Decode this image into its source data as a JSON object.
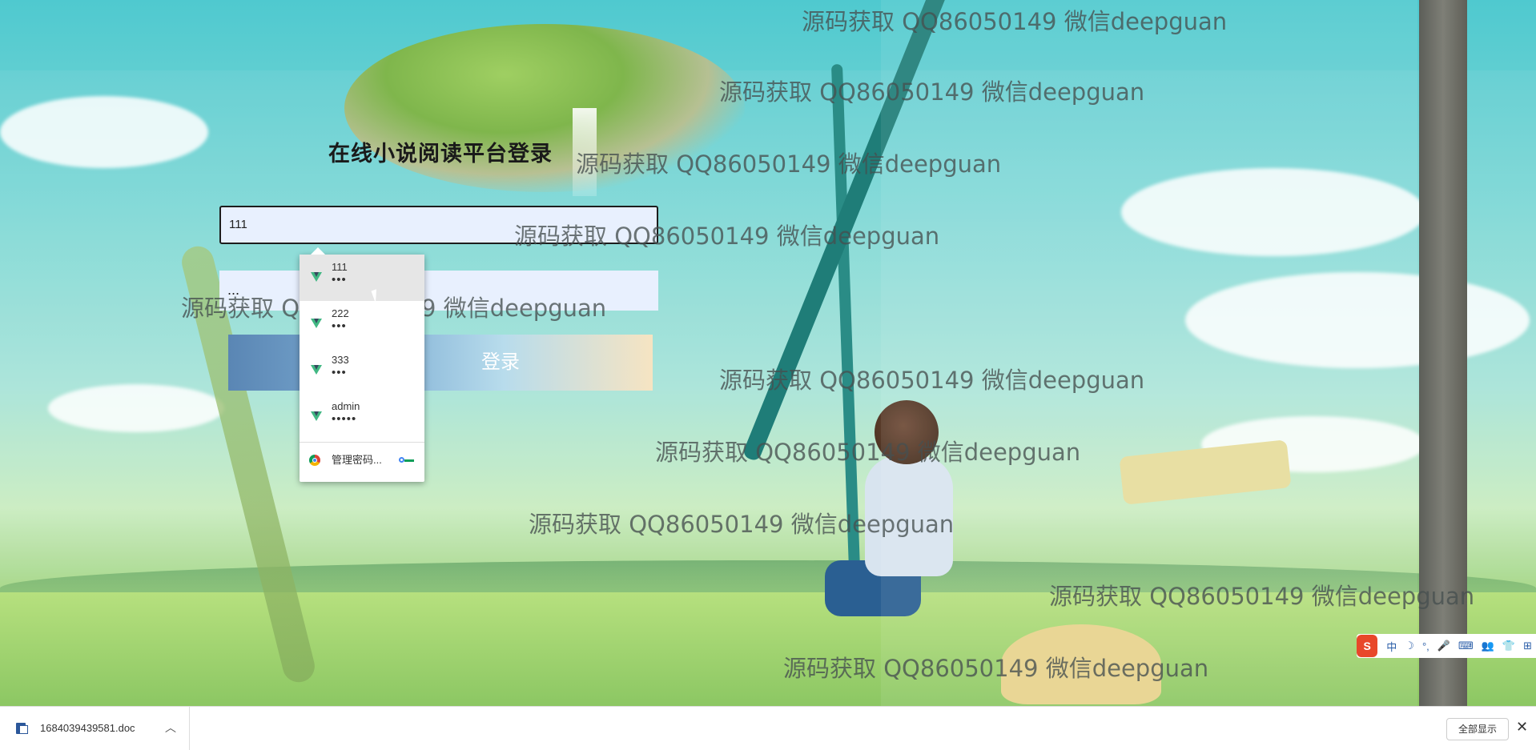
{
  "login": {
    "title": "在线小说阅读平台登录",
    "username_value": "111",
    "password_value": "...",
    "login_button": "登录"
  },
  "autofill": {
    "items": [
      {
        "user": "111",
        "pass": "•••"
      },
      {
        "user": "222",
        "pass": "•••"
      },
      {
        "user": "333",
        "pass": "•••"
      },
      {
        "user": "admin",
        "pass": "•••••"
      }
    ],
    "manage_label": "管理密码..."
  },
  "watermark": {
    "text": "源码获取 QQ86050149 微信deepguan"
  },
  "ime": {
    "logo": "S",
    "mode": "中",
    "items": [
      "☽",
      "°,",
      "🎤",
      "⌨",
      "👥",
      "👕",
      "⊞"
    ]
  },
  "download_bar": {
    "file_name": "1684039439581.doc",
    "show_all": "全部显示",
    "close": "✕",
    "chevron": "︿"
  },
  "colors": {
    "autofill_bg": "#e8f0fe",
    "vue_green": "#41b883",
    "ime_red": "#e8472a"
  }
}
